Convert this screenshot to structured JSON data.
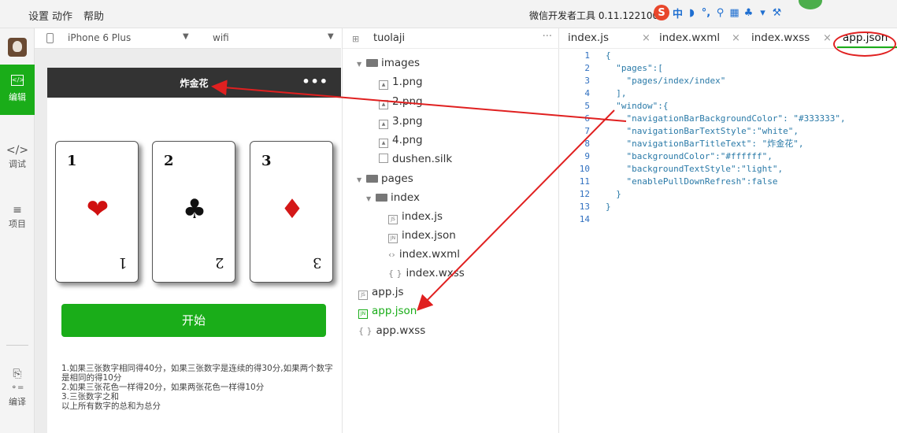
{
  "menubar": {
    "items": [
      "设置",
      "动作",
      "帮助"
    ],
    "title": "微信开发者工具 0.11.122100",
    "ime_glyphs": [
      "中",
      "♪",
      "°,",
      "🎤",
      "▦",
      "♣",
      "👕",
      "🔧"
    ]
  },
  "sidebar": {
    "items": [
      {
        "icon": "<>",
        "label": "编辑"
      },
      {
        "icon": "</>",
        "label": "调试"
      },
      {
        "icon": "≡",
        "label": "项目"
      },
      {
        "icon": "⎘",
        "label": "编译"
      }
    ]
  },
  "simulator": {
    "device": "iPhone 6 Plus",
    "network": "wifi",
    "nav_title": "炸金花",
    "nav_dots": "•••",
    "cards": [
      {
        "num": "1",
        "suit": "❤",
        "color": "#d01010"
      },
      {
        "num": "2",
        "suit": "♣",
        "color": "#111111"
      },
      {
        "num": "3",
        "suit": "♦",
        "color": "#d41818"
      }
    ],
    "start_label": "开始",
    "rules": [
      "1.如果三张数字相同得40分，如果三张数字是连续的得30分,如果两个数字是相同的得10分",
      "2.如果三张花色一样得20分，如果两张花色一样得10分",
      "3.三张数字之和",
      "以上所有数字的总和为总分"
    ]
  },
  "tree": {
    "project": "tuolaji",
    "more": "···",
    "nodes": [
      {
        "label": "images",
        "type": "folder"
      },
      {
        "label": "1.png",
        "type": "file"
      },
      {
        "label": "2.png",
        "type": "file"
      },
      {
        "label": "3.png",
        "type": "file"
      },
      {
        "label": "4.png",
        "type": "file"
      },
      {
        "label": "dushen.silk",
        "type": "file"
      },
      {
        "label": "pages",
        "type": "folder"
      },
      {
        "label": "index",
        "type": "folder"
      },
      {
        "label": "index.js",
        "type": "file"
      },
      {
        "label": "index.json",
        "type": "file"
      },
      {
        "label": "index.wxml",
        "type": "file"
      },
      {
        "label": "index.wxss",
        "type": "file"
      },
      {
        "label": "app.js",
        "type": "file"
      },
      {
        "label": "app.json",
        "type": "file"
      },
      {
        "label": "app.wxss",
        "type": "file"
      }
    ]
  },
  "editor": {
    "tabs": [
      "index.js",
      "index.wxml",
      "index.wxss",
      "app.json"
    ],
    "tab_close": "×",
    "line_numbers": [
      "1",
      "2",
      "3",
      "4",
      "5",
      "6",
      "7",
      "8",
      "9",
      "10",
      "11",
      "12",
      "13",
      "14"
    ],
    "lines": [
      "{",
      "  \"pages\":[",
      "    \"pages/index/index\"",
      "  ],",
      "  \"window\":{",
      "    \"navigationBarBackgroundColor\": \"#333333\",",
      "    \"navigationBarTextStyle\":\"white\",",
      "    \"navigationBarTitleText\": \"炸金花\",",
      "    \"backgroundColor\":\"#ffffff\",",
      "    \"backgroundTextStyle\":\"light\",",
      "    \"enablePullDownRefresh\":false",
      "  }",
      "}",
      ""
    ]
  },
  "colors": {
    "accent": "#1aad19",
    "navbar": "#333333",
    "annotation": "#e02020"
  }
}
